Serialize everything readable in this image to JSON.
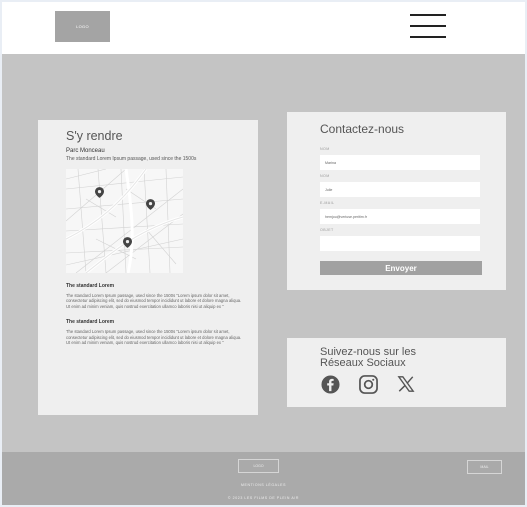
{
  "header": {
    "logo": "LOGO"
  },
  "directions": {
    "title": "S'y rendre",
    "place": "Parc Monceau",
    "description": "The standard Lorem Ipsum passage, used since the 1500s",
    "blocks": [
      {
        "title": "The standard Lorem",
        "text": "The standard Lorem Ipsum passage, used since the 1500s \"Lorem ipsum dolor sit amet, consectetur adipiscing elit, sed do eiusmod tempor incididunt ut labore et dolore magna aliqua. Ut enim ad minim veniam, quis nostrud exercitation ullamco laboris nisi ut aliquip ex \""
      },
      {
        "title": "The standard Lorem",
        "text": "The standard Lorem Ipsum passage, used since the 1500s \"Lorem ipsum dolor sit amet, consectetur adipiscing elit, sed do eiusmod tempor incididunt ut labore et dolore magna aliqua. Ut enim ad minim veniam, quis nostrud exercitation ullamco laboris nisi ut aliquip ex \""
      }
    ]
  },
  "contact": {
    "title": "Contactez-nous",
    "fields": [
      {
        "label": "NOM",
        "value": "Marina"
      },
      {
        "label": "NOM",
        "value": "Julie"
      },
      {
        "label": "E-MAIL",
        "value": "hemjou@veriuse.peritim.fr"
      },
      {
        "label": "OBJET",
        "value": ""
      }
    ],
    "send": "Envoyer"
  },
  "social": {
    "title": "Suivez-nous sur les Réseaux Sociaux",
    "icons": [
      "facebook-icon",
      "instagram-icon",
      "x-icon"
    ]
  },
  "footer": {
    "logo": "LOGO",
    "legal": "MENTIONS LÉGALES",
    "copyright": "© 2023 LES FILMS DE PLEIN AIR",
    "button": "MAIL"
  },
  "colors": {
    "card": "#efefef",
    "bg": "#c4c4c4",
    "footer": "#aaaaaa",
    "button": "#a1a1a1"
  }
}
